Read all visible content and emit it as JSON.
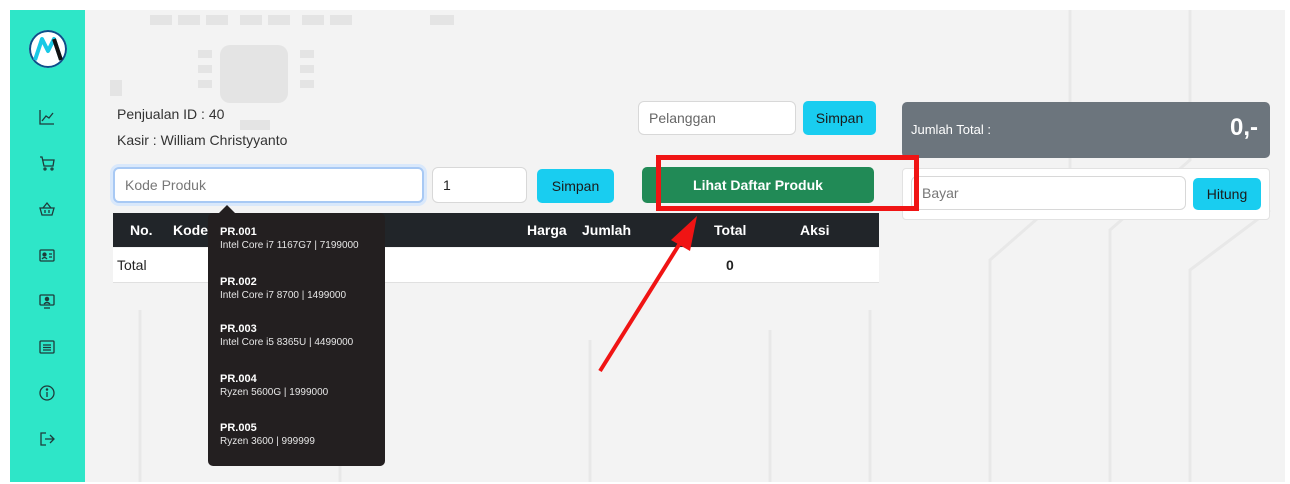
{
  "sidebar": {
    "logo": "logo-icon",
    "items": [
      {
        "icon": "chart-icon"
      },
      {
        "icon": "cart-icon"
      },
      {
        "icon": "basket-icon"
      },
      {
        "icon": "id-card-icon"
      },
      {
        "icon": "monitor-user-icon"
      },
      {
        "icon": "list-icon"
      },
      {
        "icon": "info-icon"
      },
      {
        "icon": "logout-icon"
      }
    ]
  },
  "info": {
    "sale_id": "Penjualan ID : 40",
    "cashier": "Kasir : William Christyyanto"
  },
  "customer": {
    "placeholder": "Pelanggan",
    "save_label": "Simpan"
  },
  "product_entry": {
    "placeholder": "Kode Produk",
    "qty": "1",
    "save_label": "Simpan",
    "list_label": "Lihat Daftar Produk"
  },
  "total_card": {
    "label": "Jumlah Total :",
    "value": "0,-"
  },
  "payment": {
    "placeholder": "Bayar",
    "calc_label": "Hitung"
  },
  "table": {
    "headers": {
      "no": "No.",
      "code": "Kode",
      "price": "Harga",
      "qty": "Jumlah",
      "total": "Total",
      "action": "Aksi"
    },
    "footer": {
      "label": "Total",
      "value": "0"
    }
  },
  "suggestions": [
    {
      "code": "PR.001",
      "desc": "Intel Core i7 1167G7 | 7199000"
    },
    {
      "code": "PR.002",
      "desc": "Intel Core i7 8700 | 1499000"
    },
    {
      "code": "PR.003",
      "desc": "Intel Core i5 8365U | 4499000"
    },
    {
      "code": "PR.004",
      "desc": "Ryzen 5600G | 1999000"
    },
    {
      "code": "PR.005",
      "desc": "Ryzen 3600 | 999999"
    }
  ],
  "colors": {
    "sidebar": "#2ee6c8",
    "accent": "#19cdf0",
    "success": "#218a56",
    "dark": "#212529",
    "highlight": "#f01414"
  }
}
